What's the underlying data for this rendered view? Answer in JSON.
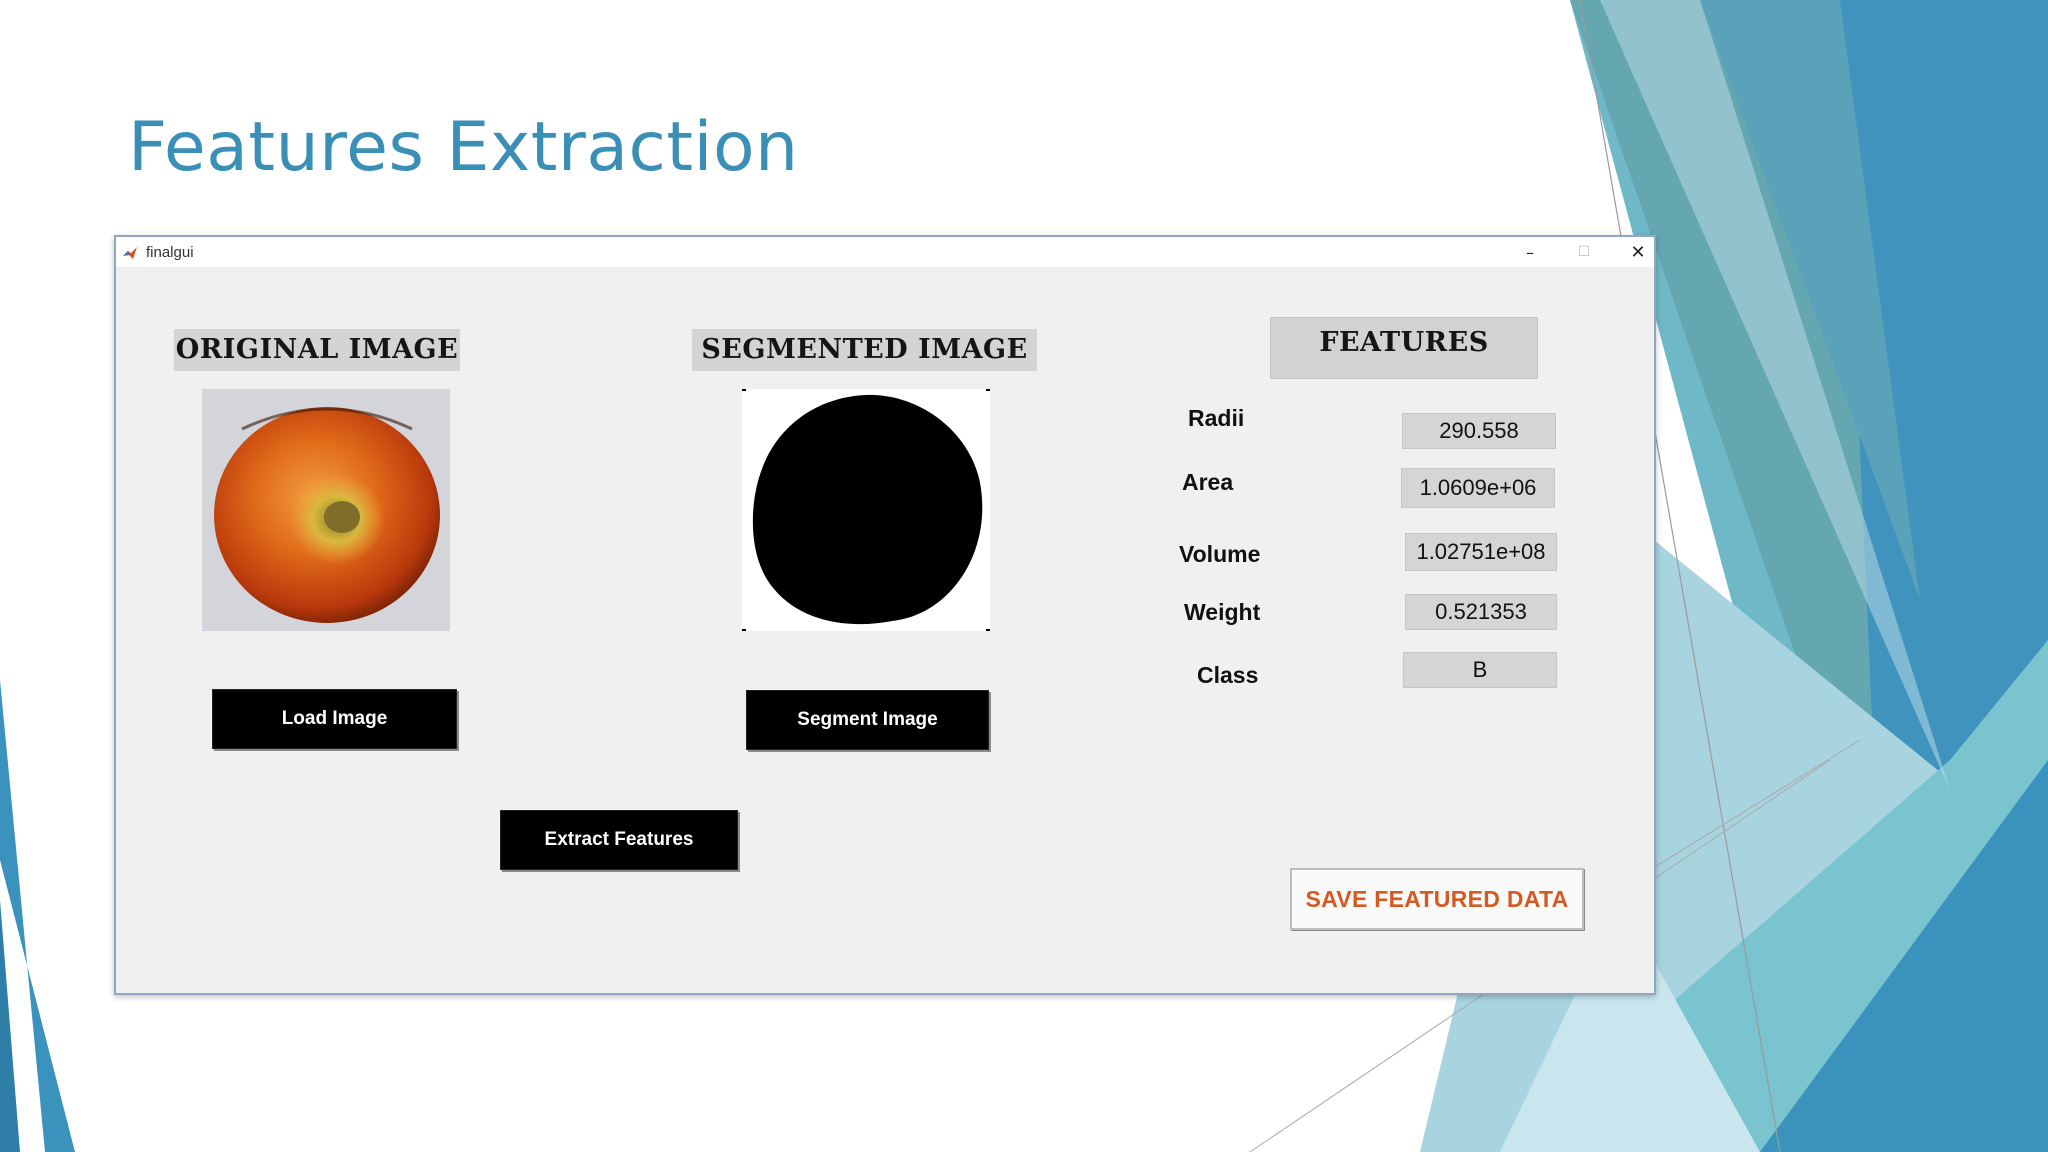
{
  "slide": {
    "title": "Features Extraction"
  },
  "window": {
    "title": "finalgui",
    "minimize_glyph": "–",
    "maximize_glyph": "☐",
    "close_glyph": "✕"
  },
  "panels": {
    "original_heading": "ORIGINAL IMAGE",
    "segmented_heading": "SEGMENTED IMAGE",
    "features_heading": "FEATURES"
  },
  "buttons": {
    "load_image": "Load Image",
    "segment_image": "Segment Image",
    "extract_features": "Extract Features",
    "save_featured_data": "SAVE FEATURED DATA"
  },
  "features": {
    "radii": {
      "label": "Radii",
      "value": "290.558"
    },
    "area": {
      "label": "Area",
      "value": "1.0609e+06"
    },
    "volume": {
      "label": "Volume",
      "value": "1.02751e+08"
    },
    "weight": {
      "label": "Weight",
      "value": "0.521353"
    },
    "class": {
      "label": "Class",
      "value": "B"
    }
  },
  "colors": {
    "title_blue": "#3a8fb7",
    "save_text": "#d35a22",
    "button_bg": "#000000",
    "window_bg": "#f0f0f0"
  },
  "icons": [
    "matlab-icon",
    "minimize-icon",
    "maximize-icon",
    "close-icon"
  ]
}
